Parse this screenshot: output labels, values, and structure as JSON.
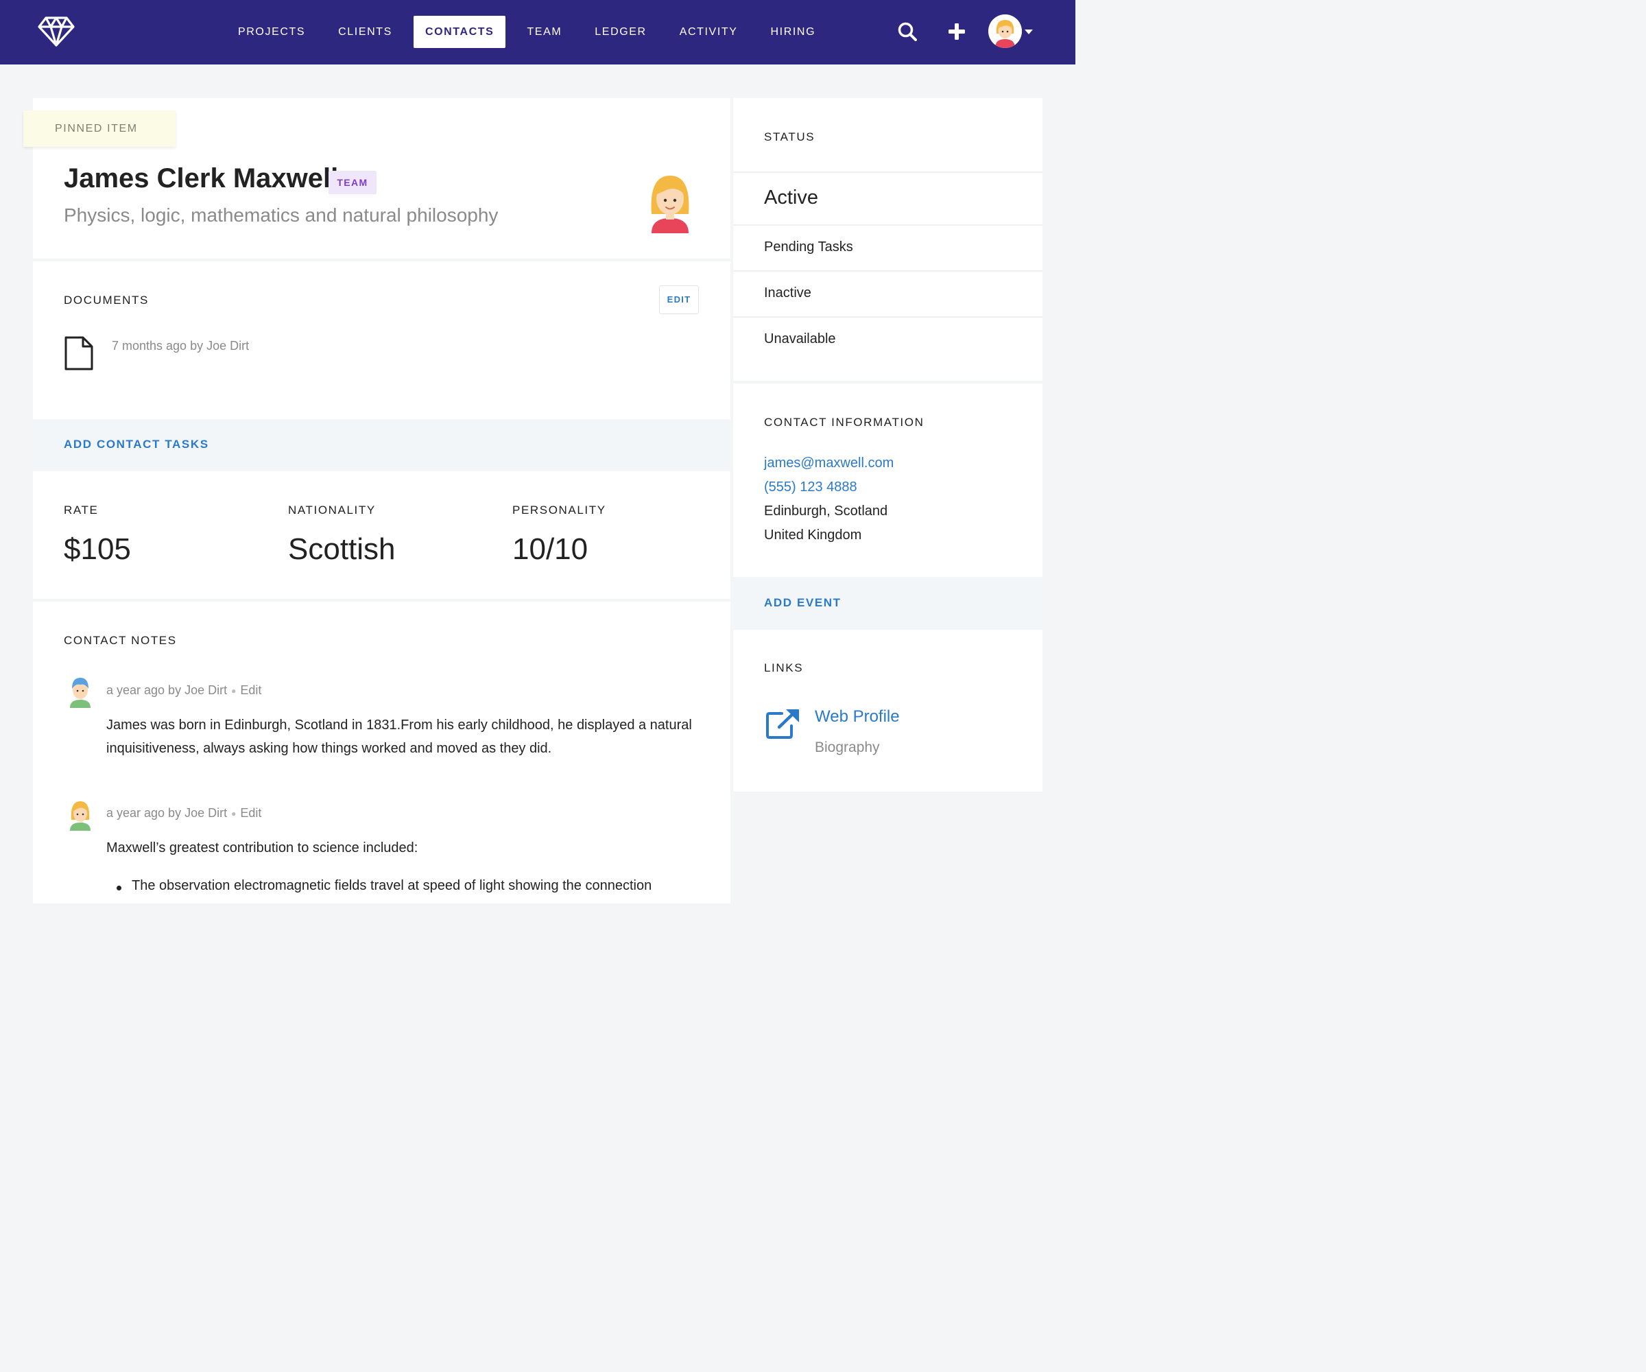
{
  "nav": {
    "items": [
      {
        "label": "PROJECTS"
      },
      {
        "label": "CLIENTS"
      },
      {
        "label": "CONTACTS",
        "active": true
      },
      {
        "label": "TEAM"
      },
      {
        "label": "LEDGER"
      },
      {
        "label": "ACTIVITY"
      },
      {
        "label": "HIRING"
      }
    ],
    "icons": {
      "logo": "diamond-icon",
      "search": "search-icon",
      "add": "plus-icon",
      "menu": "caret-down-icon"
    }
  },
  "profile": {
    "pinned_label": "PINNED ITEM",
    "name": "James Clerk Maxwell",
    "badge": "TEAM",
    "subtitle": "Physics, logic, mathematics and natural philosophy"
  },
  "documents": {
    "title": "DOCUMENTS",
    "edit_label": "EDIT",
    "items": [
      {
        "meta": "7 months ago by Joe Dirt"
      }
    ]
  },
  "add_tasks_label": "ADD CONTACT TASKS",
  "stats": [
    {
      "label": "RATE",
      "value": "$105"
    },
    {
      "label": "NATIONALITY",
      "value": "Scottish"
    },
    {
      "label": "PERSONALITY",
      "value": "10/10"
    }
  ],
  "notes": {
    "title": "CONTACT NOTES",
    "items": [
      {
        "meta": "a year ago by Joe Dirt",
        "edit_label": "Edit",
        "text": "James was born in Edinburgh, Scotland in 1831.From his early childhood, he displayed a natural inquisitiveness, always asking how things worked and moved as they did."
      },
      {
        "meta": "a year ago by Joe Dirt",
        "edit_label": "Edit",
        "text": "Maxwell’s greatest contribution to science included:",
        "bullets": [
          "The observation electromagnetic fields travel at speed of light showing the connection"
        ]
      }
    ]
  },
  "status": {
    "title": "STATUS",
    "current": "Active",
    "options": [
      "Pending Tasks",
      "Inactive",
      "Unavailable"
    ]
  },
  "contact_info": {
    "title": "CONTACT INFORMATION",
    "email": "james@maxwell.com",
    "phone": "(555) 123 4888",
    "city": "Edinburgh, Scotland",
    "country": "United Kingdom"
  },
  "add_event_label": "ADD EVENT",
  "links": {
    "title": "LINKS",
    "items": [
      {
        "label": "Web Profile",
        "sublabel": "Biography",
        "icon": "external-link-icon"
      }
    ]
  },
  "colors": {
    "navbar": "#2e2780",
    "link": "#2b7ac9",
    "badge_bg": "#f0e6fb",
    "badge_text": "#7b3fc4",
    "pinned_bg": "#fcfce6",
    "page_bg": "#f4f5f7"
  }
}
